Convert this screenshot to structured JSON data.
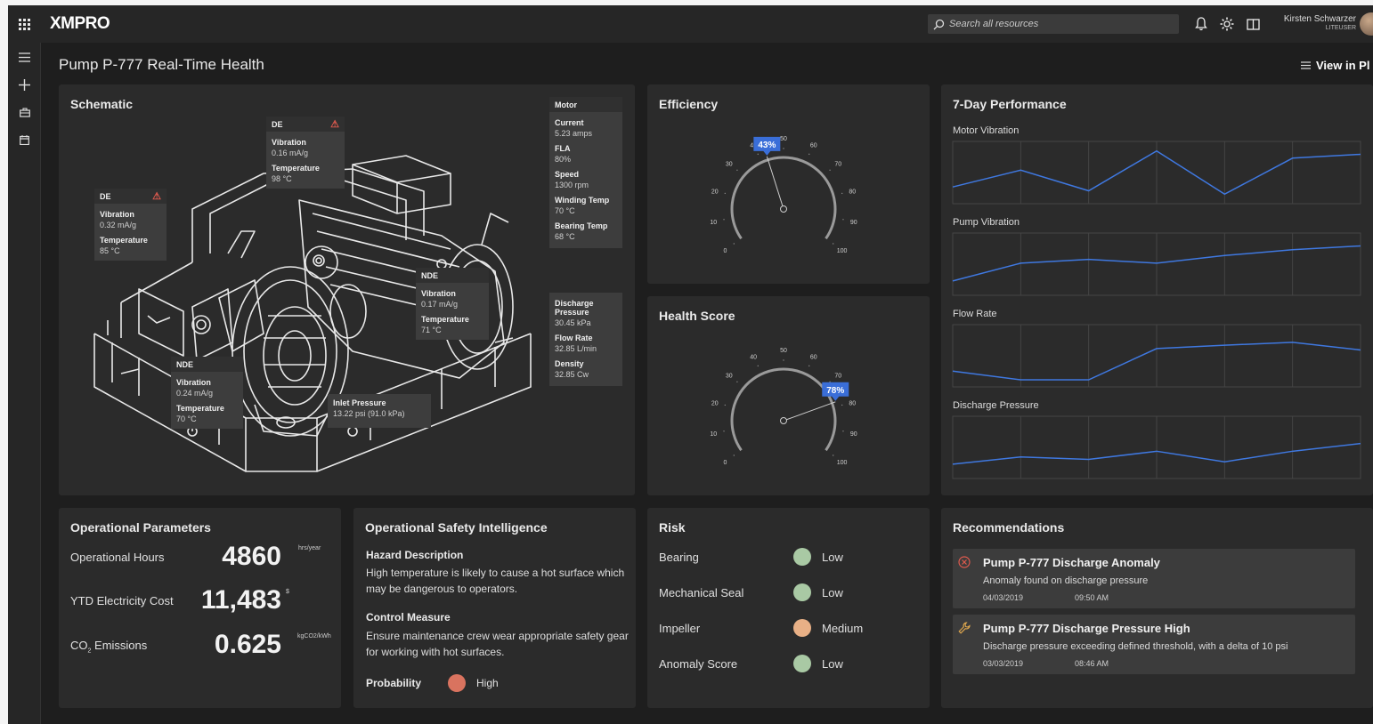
{
  "app": {
    "logo": "XMPRO"
  },
  "search": {
    "placeholder": "Search all resources"
  },
  "user": {
    "name": "Kirsten Schwarzer",
    "role": "LITEUSER"
  },
  "page": {
    "title": "Pump P-777 Real-Time Health",
    "view_in_label": "View in Pl"
  },
  "schematic": {
    "title": "Schematic",
    "de_top": {
      "title": "DE",
      "k1": "Vibration",
      "v1": "0.16 mA/g",
      "k2": "Temperature",
      "v2": "98 °C"
    },
    "de_left": {
      "title": "DE",
      "k1": "Vibration",
      "v1": "0.32 mA/g",
      "k2": "Temperature",
      "v2": "85 °C"
    },
    "nde_right": {
      "title": "NDE",
      "k1": "Vibration",
      "v1": "0.17 mA/g",
      "k2": "Temperature",
      "v2": "71 °C"
    },
    "nde_bottom": {
      "title": "NDE",
      "k1": "Vibration",
      "v1": "0.24 mA/g",
      "k2": "Temperature",
      "v2": "70 °C"
    },
    "inlet": {
      "k": "Inlet Pressure",
      "v": "13.22 psi (91.0 kPa)"
    },
    "motor": {
      "title": "Motor",
      "items": [
        {
          "k": "Current",
          "v": "5.23 amps"
        },
        {
          "k": "FLA",
          "v": "80%"
        },
        {
          "k": "Speed",
          "v": "1300 rpm"
        },
        {
          "k": "Winding Temp",
          "v": "70 °C"
        },
        {
          "k": "Bearing Temp",
          "v": "68 °C"
        }
      ]
    },
    "pump": {
      "items": [
        {
          "k": "Discharge Pressure",
          "v": "30.45 kPa"
        },
        {
          "k": "Flow Rate",
          "v": "32.85 L/min"
        },
        {
          "k": "Density",
          "v": "32.85 Cw"
        }
      ]
    }
  },
  "efficiency": {
    "title": "Efficiency",
    "value": 43,
    "label": "43%"
  },
  "health": {
    "title": "Health Score",
    "value": 78,
    "label": "78%"
  },
  "gauge_ticks": [
    "0",
    "10",
    "20",
    "30",
    "40",
    "50",
    "60",
    "70",
    "80",
    "90",
    "100"
  ],
  "performance": {
    "title": "7-Day Performance",
    "charts": [
      {
        "name": "Motor Vibration",
        "values": [
          0.2,
          0.55,
          0.12,
          0.95,
          0.05,
          0.8,
          0.88
        ]
      },
      {
        "name": "Pump Vibration",
        "values": [
          0.15,
          0.52,
          0.6,
          0.52,
          0.68,
          0.8,
          0.88
        ]
      },
      {
        "name": "Flow Rate",
        "values": [
          0.18,
          0.0,
          0.0,
          0.65,
          0.72,
          0.78,
          0.62
        ]
      },
      {
        "name": "Discharge Pressure",
        "values": [
          0.15,
          0.3,
          0.25,
          0.42,
          0.2,
          0.42,
          0.58
        ]
      }
    ]
  },
  "operational": {
    "title": "Operational Parameters",
    "rows": [
      {
        "label": "Operational Hours",
        "value": "4860",
        "unit": "hrs/year"
      },
      {
        "label": "YTD Electricity Cost",
        "value": "11,483",
        "unit": "$"
      },
      {
        "label": "CO",
        "sub": "2",
        "label_rest": " Emissions",
        "value": "0.625",
        "unit": "kgCO2/kWh"
      }
    ]
  },
  "safety": {
    "title": "Operational Safety Intelligence",
    "hazard_h": "Hazard Description",
    "hazard_t": "High temperature is likely to cause a hot surface which may be dangerous to operators.",
    "control_h": "Control Measure",
    "control_t": "Ensure maintenance crew wear appropriate safety gear for working with hot surfaces.",
    "prob_h": "Probability",
    "prob_v": "High",
    "prob_color": "#d9735f"
  },
  "risk": {
    "title": "Risk",
    "rows": [
      {
        "label": "Bearing",
        "level": "Low",
        "color": "#a9c9a4"
      },
      {
        "label": "Mechanical Seal",
        "level": "Low",
        "color": "#a9c9a4"
      },
      {
        "label": "Impeller",
        "level": "Medium",
        "color": "#e8b086"
      },
      {
        "label": "Anomaly Score",
        "level": "Low",
        "color": "#a9c9a4"
      }
    ]
  },
  "recommendations": {
    "title": "Recommendations",
    "items": [
      {
        "icon": "error-circle-icon",
        "title": "Pump P-777 Discharge Anomaly",
        "desc": "Anomaly found on discharge pressure",
        "date": "04/03/2019",
        "time": "09:50 AM"
      },
      {
        "icon": "wrench-icon",
        "title": "Pump P-777 Discharge Pressure High",
        "desc": "Discharge pressure exceeding defined threshold, with a delta of 10 psi",
        "date": "03/03/2019",
        "time": "08:46 AM"
      }
    ]
  },
  "colors": {
    "accent": "#3f78e0",
    "gauge_badge": "#3a6ed8",
    "error": "#e05a4e",
    "wrench": "#e0a84e"
  }
}
